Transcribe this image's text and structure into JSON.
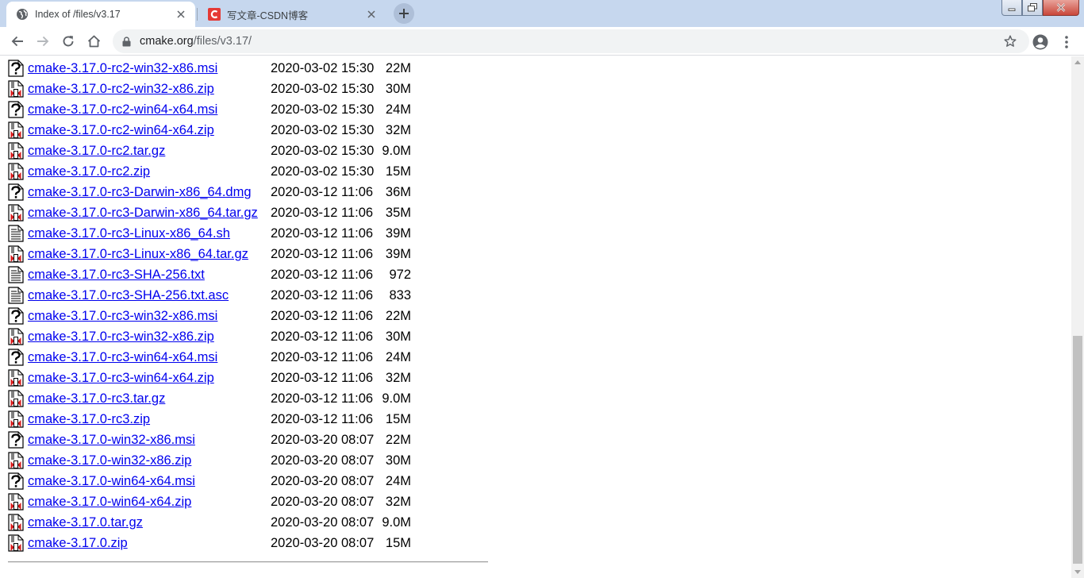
{
  "browser": {
    "tabs": [
      {
        "title": "Index of /files/v3.17",
        "active": true,
        "icon": "globe-icon"
      },
      {
        "title": "写文章-CSDN博客",
        "active": false,
        "icon": "csdn-logo-icon"
      }
    ],
    "url_host": "cmake.org",
    "url_path": "/files/v3.17/",
    "accent_colors": {
      "tabstrip": "#c6d7ee",
      "link": "#0000ee",
      "csdn": "#e53935"
    }
  },
  "files": [
    {
      "icon": "unknown",
      "name": "cmake-3.17.0-rc2-win32-x86.msi",
      "modified": "2020-03-02 15:30",
      "size": "22M"
    },
    {
      "icon": "compressed",
      "name": "cmake-3.17.0-rc2-win32-x86.zip",
      "modified": "2020-03-02 15:30",
      "size": "30M"
    },
    {
      "icon": "unknown",
      "name": "cmake-3.17.0-rc2-win64-x64.msi",
      "modified": "2020-03-02 15:30",
      "size": "24M"
    },
    {
      "icon": "compressed",
      "name": "cmake-3.17.0-rc2-win64-x64.zip",
      "modified": "2020-03-02 15:30",
      "size": "32M"
    },
    {
      "icon": "compressed",
      "name": "cmake-3.17.0-rc2.tar.gz",
      "modified": "2020-03-02 15:30",
      "size": "9.0M"
    },
    {
      "icon": "compressed",
      "name": "cmake-3.17.0-rc2.zip",
      "modified": "2020-03-02 15:30",
      "size": "15M"
    },
    {
      "icon": "unknown",
      "name": "cmake-3.17.0-rc3-Darwin-x86_64.dmg",
      "modified": "2020-03-12 11:06",
      "size": "36M"
    },
    {
      "icon": "compressed",
      "name": "cmake-3.17.0-rc3-Darwin-x86_64.tar.gz",
      "modified": "2020-03-12 11:06",
      "size": "35M"
    },
    {
      "icon": "text",
      "name": "cmake-3.17.0-rc3-Linux-x86_64.sh",
      "modified": "2020-03-12 11:06",
      "size": "39M"
    },
    {
      "icon": "compressed",
      "name": "cmake-3.17.0-rc3-Linux-x86_64.tar.gz",
      "modified": "2020-03-12 11:06",
      "size": "39M"
    },
    {
      "icon": "text",
      "name": "cmake-3.17.0-rc3-SHA-256.txt",
      "modified": "2020-03-12 11:06",
      "size": "972"
    },
    {
      "icon": "text",
      "name": "cmake-3.17.0-rc3-SHA-256.txt.asc",
      "modified": "2020-03-12 11:06",
      "size": "833"
    },
    {
      "icon": "unknown",
      "name": "cmake-3.17.0-rc3-win32-x86.msi",
      "modified": "2020-03-12 11:06",
      "size": "22M"
    },
    {
      "icon": "compressed",
      "name": "cmake-3.17.0-rc3-win32-x86.zip",
      "modified": "2020-03-12 11:06",
      "size": "30M"
    },
    {
      "icon": "unknown",
      "name": "cmake-3.17.0-rc3-win64-x64.msi",
      "modified": "2020-03-12 11:06",
      "size": "24M"
    },
    {
      "icon": "compressed",
      "name": "cmake-3.17.0-rc3-win64-x64.zip",
      "modified": "2020-03-12 11:06",
      "size": "32M"
    },
    {
      "icon": "compressed",
      "name": "cmake-3.17.0-rc3.tar.gz",
      "modified": "2020-03-12 11:06",
      "size": "9.0M"
    },
    {
      "icon": "compressed",
      "name": "cmake-3.17.0-rc3.zip",
      "modified": "2020-03-12 11:06",
      "size": "15M"
    },
    {
      "icon": "unknown",
      "name": "cmake-3.17.0-win32-x86.msi",
      "modified": "2020-03-20 08:07",
      "size": "22M"
    },
    {
      "icon": "compressed",
      "name": "cmake-3.17.0-win32-x86.zip",
      "modified": "2020-03-20 08:07",
      "size": "30M"
    },
    {
      "icon": "unknown",
      "name": "cmake-3.17.0-win64-x64.msi",
      "modified": "2020-03-20 08:07",
      "size": "24M"
    },
    {
      "icon": "compressed",
      "name": "cmake-3.17.0-win64-x64.zip",
      "modified": "2020-03-20 08:07",
      "size": "32M"
    },
    {
      "icon": "compressed",
      "name": "cmake-3.17.0.tar.gz",
      "modified": "2020-03-20 08:07",
      "size": "9.0M"
    },
    {
      "icon": "compressed",
      "name": "cmake-3.17.0.zip",
      "modified": "2020-03-20 08:07",
      "size": "15M"
    }
  ]
}
